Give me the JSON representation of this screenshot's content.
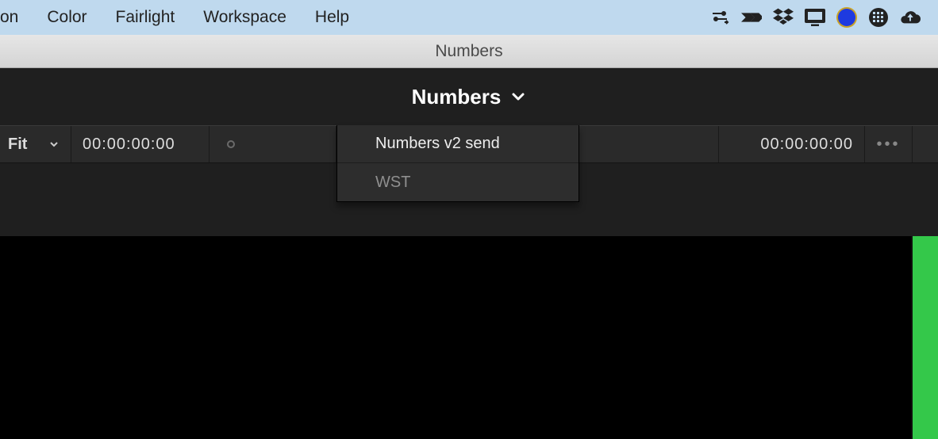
{
  "mac_menu": {
    "items": [
      "on",
      "Color",
      "Fairlight",
      "Workspace",
      "Help"
    ]
  },
  "window": {
    "title": "Numbers"
  },
  "project": {
    "title": "Numbers"
  },
  "toolbar": {
    "fit_label": "Fit",
    "tc_left": "00:00:00:00",
    "tc_right": "00:00:00:00",
    "more_label": "•••"
  },
  "dropdown": {
    "items": [
      {
        "label": "Numbers v2 send",
        "dimmed": false
      },
      {
        "label": "WST",
        "dimmed": true
      }
    ]
  }
}
